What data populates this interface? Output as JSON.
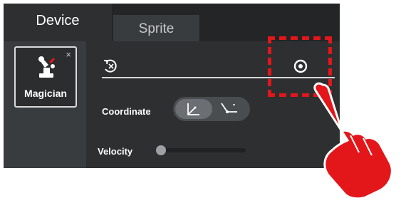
{
  "tabs": {
    "device_label": "Device",
    "sprite_label": "Sprite"
  },
  "device": {
    "name": "Magician",
    "close_symbol": "×"
  },
  "controls": {
    "coordinate_label": "Coordinate",
    "velocity_label": "Velocity",
    "velocity_level_fraction": 0.0,
    "coordinate_selected": "cartesian"
  },
  "icons": {
    "reset": "reset-icon",
    "target": "target-icon",
    "robot": "robot-arm-icon",
    "cartesian": "cartesian-coordinate-icon",
    "joint": "joint-coordinate-icon",
    "pointer": "pointing-hand-icon"
  },
  "colors": {
    "panel_bg": "#2d2f31",
    "tab_bar_bg": "#232527",
    "highlight_red": "#e3161a",
    "text": "#ffffff"
  }
}
